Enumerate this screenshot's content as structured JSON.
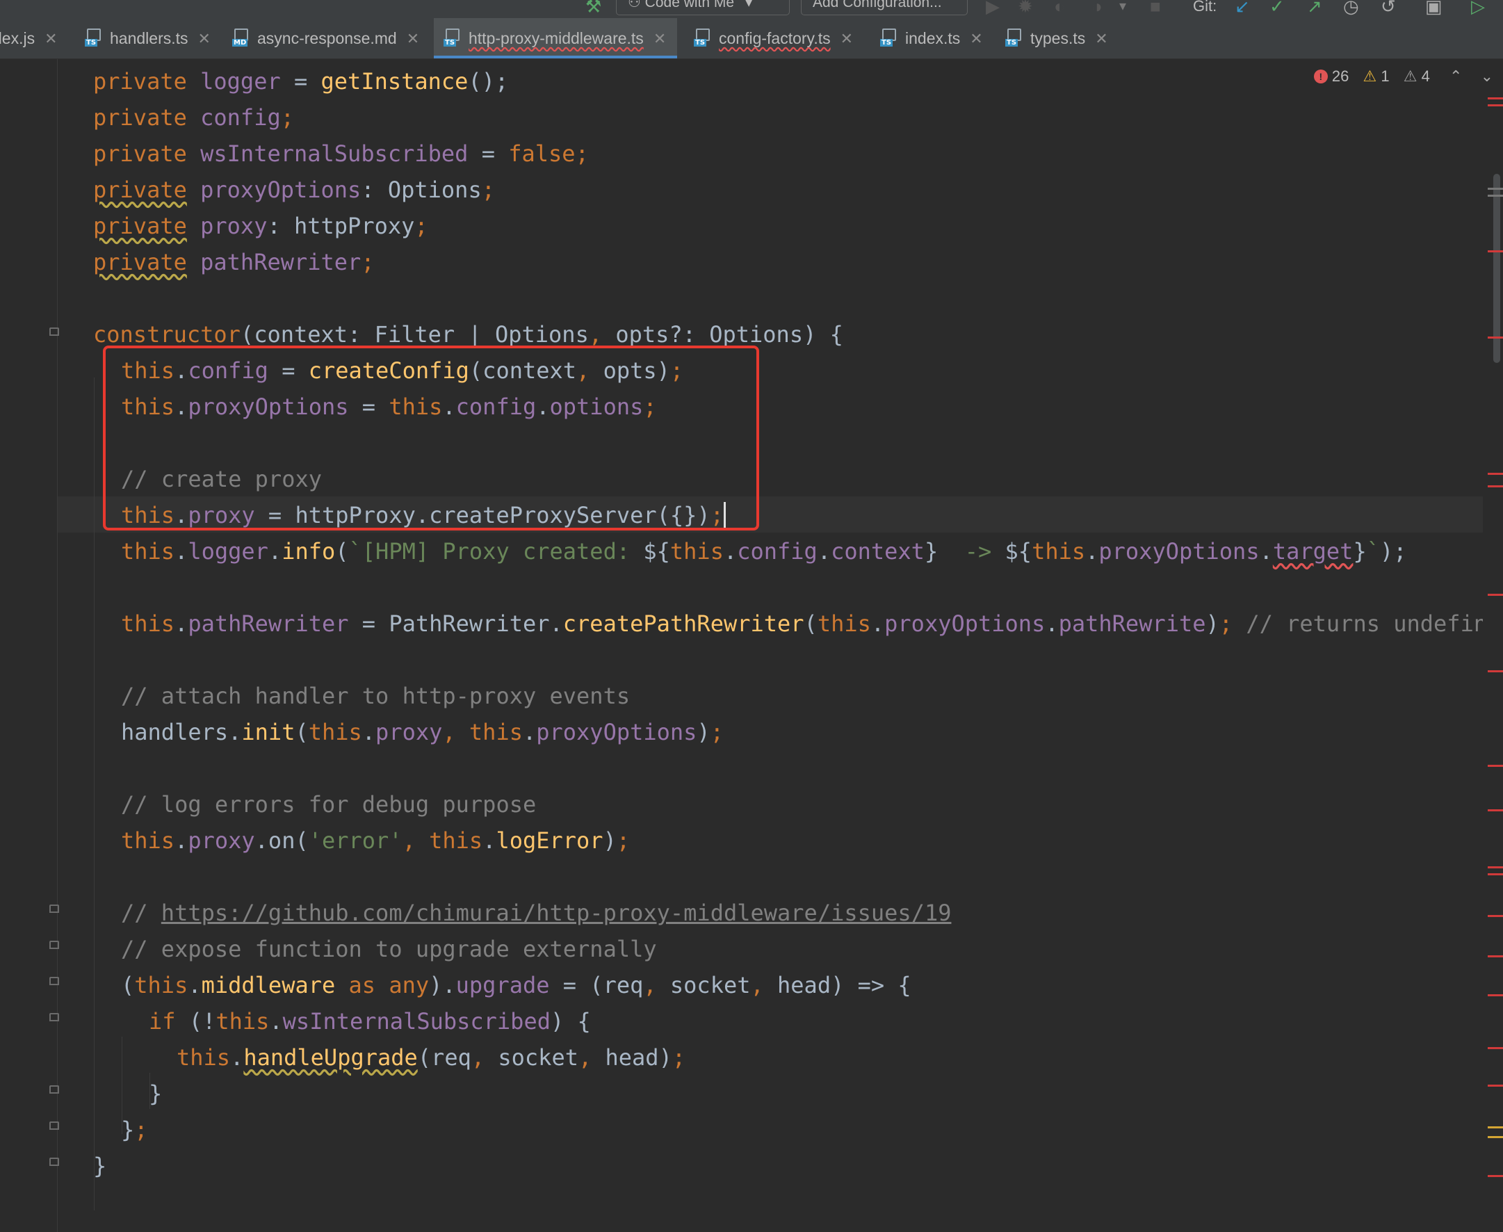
{
  "toolbar": {
    "code_with_me": "Code with Me",
    "add_configuration": "Add Configuration...",
    "git_label": "Git:"
  },
  "tabs": [
    {
      "label": "dex.js",
      "file_type": "JS"
    },
    {
      "label": "handlers.ts",
      "file_type": "TS"
    },
    {
      "label": "async-response.md",
      "file_type": "MD"
    },
    {
      "label": "http-proxy-middleware.ts",
      "file_type": "TS",
      "active": true
    },
    {
      "label": "config-factory.ts",
      "file_type": "TS"
    },
    {
      "label": "index.ts",
      "file_type": "TS"
    },
    {
      "label": "types.ts",
      "file_type": "TS"
    }
  ],
  "inspections": {
    "errors": "26",
    "warnings": "1",
    "weak_warnings": "4"
  },
  "code": {
    "l1": {
      "a": "private",
      "b": "logger",
      "c": " = ",
      "d": "getInstance",
      "e": "();"
    },
    "l2": {
      "a": "private",
      "b": "config",
      "c": ";"
    },
    "l3": {
      "a": "private",
      "b": "wsInternalSubscribed",
      "c": " = ",
      "d": "false",
      "e": ";"
    },
    "l4": {
      "a": "private",
      "b": "proxyOptions",
      "c": ": Options",
      "d": ";"
    },
    "l5": {
      "a": "private",
      "b": "proxy",
      "c": ": httpProxy",
      "d": ";"
    },
    "l6": {
      "a": "private",
      "b": "pathRewriter",
      "c": ";"
    },
    "l7": {
      "a": "constructor",
      "b": "(context: Filter | Options",
      "c": ", ",
      "d": "opts?: Options) {"
    },
    "l8": {
      "a": "this",
      "b": ".",
      "c": "config",
      "d": " = ",
      "e": "createConfig",
      "f": "(context",
      "g": ", ",
      "h": "opts)",
      "i": ";"
    },
    "l9": {
      "a": "this",
      "b": ".",
      "c": "proxyOptions",
      "d": " = ",
      "e": "this",
      "f": ".",
      "g": "config",
      "h": ".",
      "i": "options",
      "j": ";"
    },
    "l10": {
      "a": "// create proxy"
    },
    "l11": {
      "a": "this",
      "b": ".",
      "c": "proxy",
      "d": " = httpProxy.",
      "e": "createProxyServer",
      "f": "({})",
      "g": ";"
    },
    "l12": {
      "a": "this",
      "b": ".",
      "c": "logger",
      "d": ".",
      "e": "info",
      "f": "(",
      "g": "`[HPM] Proxy created: ",
      "h": "${",
      "i": "this",
      "j": ".",
      "k": "config",
      "l": ".",
      "m": "context",
      "n": "}",
      "o": "  -> ",
      "p": "${",
      "q": "this",
      "r": ".",
      "s": "proxyOptions",
      "t": ".",
      "u": "target",
      "v": "}",
      "w": "`",
      "x": ");"
    },
    "l13": {
      "a": "this",
      "b": ".",
      "c": "pathRewriter",
      "d": " = PathRewriter.",
      "e": "createPathRewriter",
      "f": "(",
      "g": "this",
      "h": ".",
      "i": "proxyOptions",
      "j": ".",
      "k": "pathRewrite",
      "l": ")",
      "m": "; ",
      "n": "// returns undefined when \"pathRewrite\" is not provided"
    },
    "l14": {
      "a": "// attach handler to http-proxy events"
    },
    "l15": {
      "a": "handlers.",
      "b": "init",
      "c": "(",
      "d": "this",
      "e": ".",
      "f": "proxy",
      "g": ", ",
      "h": "this",
      "i": ".",
      "j": "proxyOptions",
      "k": ")",
      "l": ";"
    },
    "l16": {
      "a": "// log errors for debug purpose"
    },
    "l17": {
      "a": "this",
      "b": ".",
      "c": "proxy",
      "d": ".",
      "e": "on",
      "f": "(",
      "g": "'error'",
      "h": ", ",
      "i": "this",
      "j": ".",
      "k": "logError",
      "l": ")",
      "m": ";"
    },
    "l18": {
      "a": "// ",
      "b": "https://github.com/chimurai/http-proxy-middleware/issues/19"
    },
    "l19": {
      "a": "// expose function to upgrade externally"
    },
    "l20": {
      "a": "(",
      "b": "this",
      "c": ".",
      "d": "middleware",
      "e": " as ",
      "f": "any",
      "g": ").",
      "h": "upgrade",
      "i": " = (req",
      "j": ", ",
      "k": "socket",
      "l": ", ",
      "m": "head) => {"
    },
    "l21": {
      "a": "if",
      "b": " (!",
      "c": "this",
      "d": ".",
      "e": "wsInternalSubscribed",
      "f": ") {"
    },
    "l22": {
      "a": "this",
      "b": ".",
      "c": "handleUpgrade",
      "d": "(req",
      "e": ", ",
      "f": "socket",
      "g": ", ",
      "h": "head)",
      "i": ";"
    },
    "l23": {
      "a": "}"
    },
    "l24": {
      "a": "}",
      "b": ";"
    },
    "l25": {
      "a": "}"
    }
  },
  "colors": {
    "keyword": "#cc7832",
    "function": "#ffc66d",
    "property": "#9876aa",
    "string": "#6a8759",
    "comment": "#808080",
    "text": "#a9b7c6",
    "highlight_box": "#e8392f",
    "active_tab_underline": "#4a88c7"
  },
  "icons": {
    "hammer": "hammer-icon",
    "code_with_me": "code-with-me-icon",
    "run": "run-icon",
    "debug": "debug-icon",
    "coverage": "coverage-icon",
    "profile": "profile-icon",
    "stop": "stop-icon",
    "git_update": "git-update-icon",
    "git_commit": "git-commit-icon",
    "git_push": "git-push-icon",
    "git_history": "git-history-icon",
    "git_rollback": "git-rollback-icon"
  }
}
